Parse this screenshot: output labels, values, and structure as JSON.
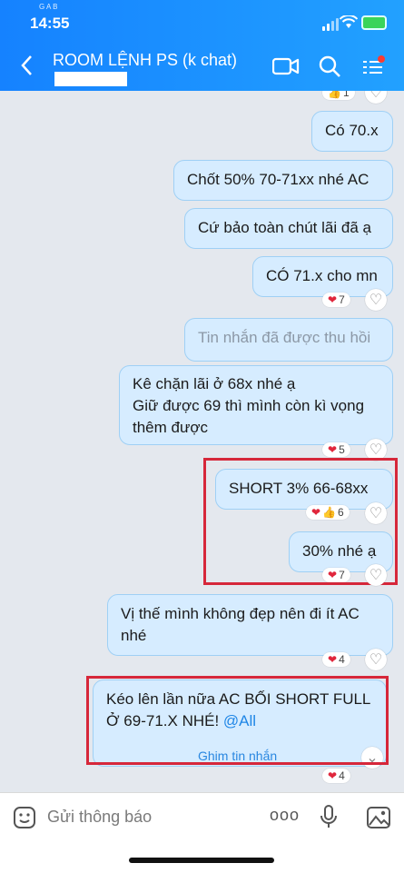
{
  "status": {
    "time": "14:55",
    "mini": "G A B"
  },
  "header": {
    "title": "ROOM LỆNH PS (k chat)",
    "back_icon": "chevron-left-icon"
  },
  "messages": [
    {
      "reaction_count": "1"
    },
    {
      "text": "Có 70.x"
    },
    {
      "text": "Chốt 50% 70-71xx nhé AC"
    },
    {
      "text": "Cứ bảo toàn chút lãi đã ạ"
    },
    {
      "text": "CÓ 71.x cho mn",
      "reaction_count": "7"
    },
    {
      "text": "Tin nhắn đã được thu hồi"
    },
    {
      "line1": "Kê chặn lãi ở 68x nhé ạ",
      "line2": "Giữ được 69 thì mình còn kì vọng",
      "line3": "thêm được",
      "reaction_count": "5"
    },
    {
      "text": "SHORT 3% 66-68xx",
      "reaction_count": "6"
    },
    {
      "text": "30% nhé ạ",
      "reaction_count": "7"
    },
    {
      "line1": "Vị thế mình không đẹp nên đi ít AC",
      "line2": "nhé",
      "reaction_count": "4"
    },
    {
      "line1": "Kéo lên lần nữa AC BỐI SHORT FULL",
      "line2": "Ở 69-71.X NHÉ!",
      "mention": "@All",
      "pin_label": "Ghim tin nhắn",
      "reaction_count": "4"
    }
  ],
  "input": {
    "placeholder": "Gửi thông báo",
    "more_label": "ooo"
  }
}
